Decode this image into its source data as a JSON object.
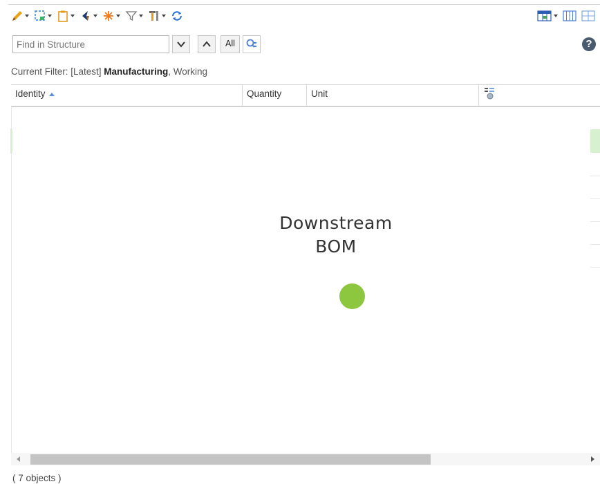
{
  "toolbar": {
    "icons": [
      "pencil-icon",
      "insert-icon",
      "clipboard-icon",
      "navigate-icon",
      "burst-icon",
      "filter-icon",
      "tools-icon",
      "refresh-icon"
    ],
    "right_icons": [
      "table-layout-icon",
      "columns-icon",
      "grid-icon"
    ]
  },
  "search": {
    "placeholder": "Find in Structure",
    "all_label": "All"
  },
  "filter": {
    "prefix": "Current Filter: [Latest] ",
    "bold": "Manufacturing",
    "suffix": ", Working"
  },
  "table": {
    "columns": [
      "Identity",
      "Quantity",
      "Unit"
    ],
    "sort": "ascending"
  },
  "watermark": {
    "line1": "Downstream",
    "line2": "BOM"
  },
  "colors": {
    "accent_dot": "#8dc63f",
    "selection_highlight": "#d7f0d0"
  },
  "status": {
    "count": "( 7 objects )"
  }
}
